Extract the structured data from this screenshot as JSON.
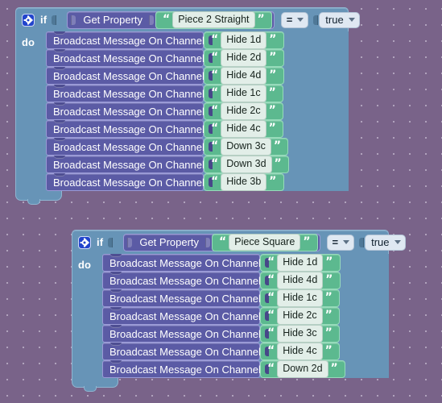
{
  "workspace": {
    "background_color": "#796389",
    "grid_dot_color": "#e1dceb"
  },
  "palette": {
    "if_block_color": "#6794b7",
    "statement_block_color": "#5b5ba5",
    "text_block_color": "#5cb98f",
    "field_color": "#e2eee8",
    "dropdown_color": "#dfe8f2",
    "gear_icon_color": "#2244cc"
  },
  "blocks": [
    {
      "id": "if-block-1",
      "mutator_icon": "gear-icon",
      "if_label": "if",
      "do_label": "do",
      "condition": {
        "getter_label": "Get Property",
        "property_name": "Piece 2 Straight",
        "open_quote": "“",
        "close_quote": "”",
        "operator": "=",
        "comparand": "true"
      },
      "statements": [
        {
          "label": "Broadcast Message On Channel",
          "message": "Hide 1d"
        },
        {
          "label": "Broadcast Message On Channel",
          "message": "Hide 2d"
        },
        {
          "label": "Broadcast Message On Channel",
          "message": "Hide 4d"
        },
        {
          "label": "Broadcast Message On Channel",
          "message": "Hide 1c"
        },
        {
          "label": "Broadcast Message On Channel",
          "message": "Hide 2c"
        },
        {
          "label": "Broadcast Message On Channel",
          "message": "Hide 4c"
        },
        {
          "label": "Broadcast Message On Channel",
          "message": "Down 3c"
        },
        {
          "label": "Broadcast Message On Channel",
          "message": "Down 3d"
        },
        {
          "label": "Broadcast Message On Channel",
          "message": "Hide 3b"
        }
      ]
    },
    {
      "id": "if-block-2",
      "mutator_icon": "gear-icon",
      "if_label": "if",
      "do_label": "do",
      "condition": {
        "getter_label": "Get Property",
        "property_name": "Piece Square",
        "open_quote": "“",
        "close_quote": "”",
        "operator": "=",
        "comparand": "true"
      },
      "statements": [
        {
          "label": "Broadcast Message On Channel",
          "message": "Hide 1d"
        },
        {
          "label": "Broadcast Message On Channel",
          "message": "Hide 4d"
        },
        {
          "label": "Broadcast Message On Channel",
          "message": "Hide 1c"
        },
        {
          "label": "Broadcast Message On Channel",
          "message": "Hide 2c"
        },
        {
          "label": "Broadcast Message On Channel",
          "message": "Hide 3c"
        },
        {
          "label": "Broadcast Message On Channel",
          "message": "Hide 4c"
        },
        {
          "label": "Broadcast Message On Channel",
          "message": "Down 2d"
        }
      ]
    }
  ]
}
